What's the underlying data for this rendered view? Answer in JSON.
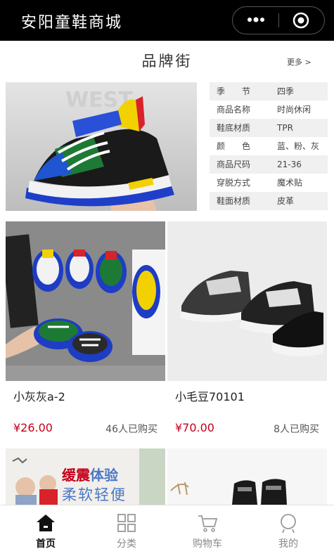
{
  "app": {
    "title": "安阳童鞋商城"
  },
  "capsule": {
    "more_icon": "more-dots-icon",
    "close_icon": "target-circle-icon"
  },
  "brand_street": {
    "title": "品牌街",
    "more_link": "更多 >"
  },
  "featured": {
    "image_desc_icon": "sneaker-photo",
    "specs": [
      {
        "label": "季　　节",
        "value": "四季"
      },
      {
        "label": "商品名称",
        "value": "时尚休闲"
      },
      {
        "label": "鞋底材质",
        "value": "TPR"
      },
      {
        "label": "颜　　色",
        "value": "蓝、粉、灰"
      },
      {
        "label": "商品尺码",
        "value": "21-36"
      },
      {
        "label": "穿脱方式",
        "value": "魔术贴"
      },
      {
        "label": "鞋面材质",
        "value": "皮革"
      }
    ]
  },
  "products": [
    {
      "name": "小灰灰a-2",
      "price": "¥26.00",
      "sold": "46人已购买"
    },
    {
      "name": "小毛豆70101",
      "price": "¥70.00",
      "sold": "8人已购买"
    }
  ],
  "promo_banner": {
    "line1_a": "缓震",
    "line1_b": "体验",
    "line2": "柔软轻便"
  },
  "tabbar": {
    "items": [
      {
        "label": "首页",
        "icon": "home-icon"
      },
      {
        "label": "分类",
        "icon": "category-grid-icon"
      },
      {
        "label": "购物车",
        "icon": "cart-icon"
      },
      {
        "label": "我的",
        "icon": "profile-icon"
      }
    ]
  },
  "colors": {
    "navbar": "#000000",
    "price": "#c4001b",
    "spec_shade": "#f0f0f0"
  }
}
